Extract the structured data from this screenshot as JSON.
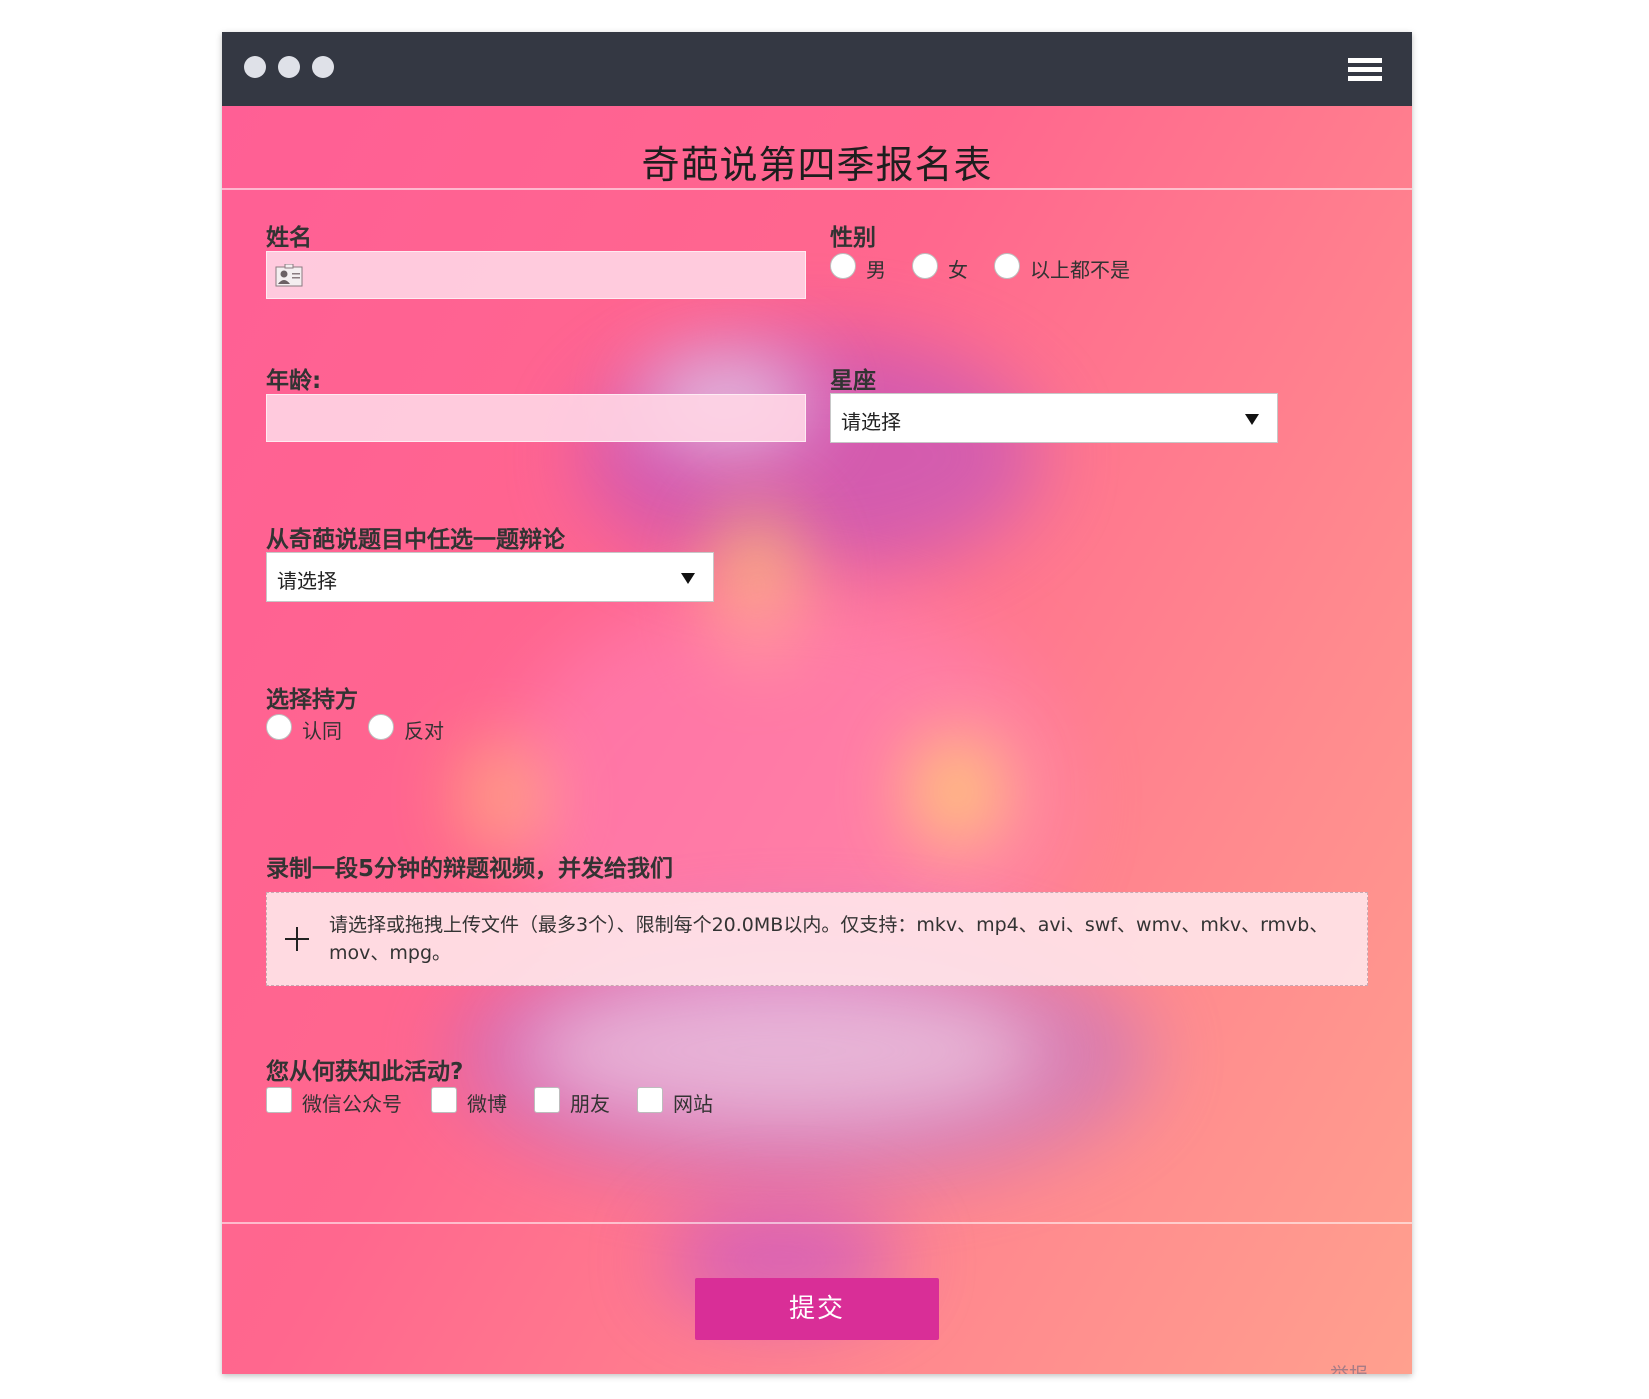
{
  "form": {
    "title": "奇葩说第四季报名表",
    "name_label": "姓名",
    "gender_label": "性别",
    "gender_options": [
      "男",
      "女",
      "以上都不是"
    ],
    "age_label": "年龄:",
    "zodiac_label": "星座",
    "zodiac_select": "请选择",
    "topic_label": "从奇葩说题目中任选一题辩论",
    "topic_select": "请选择",
    "side_label": "选择持方",
    "side_options": [
      "认同",
      "反对"
    ],
    "video_label": "录制一段5分钟的辩题视频，并发给我们",
    "upload_text": "请选择或拖拽上传文件（最多3个）、限制每个20.0MB以内。仅支持：mkv、mp4、avi、swf、wmv、mkv、rmvb、mov、mpg。",
    "source_label": "您从何获知此活动?",
    "source_options": [
      "微信公众号",
      "微博",
      "朋友",
      "网站"
    ],
    "submit_label": "提交",
    "report_label": "举报"
  },
  "icons": {
    "window_controls": "window-dot",
    "menu": "hamburger-menu-icon",
    "name_field": "contact-card-icon",
    "upload": "plus-icon"
  },
  "colors": {
    "titlebar": "#343843",
    "background_start": "#ff5f95",
    "background_end": "#ffa08e",
    "submit_button": "#d92e97"
  }
}
